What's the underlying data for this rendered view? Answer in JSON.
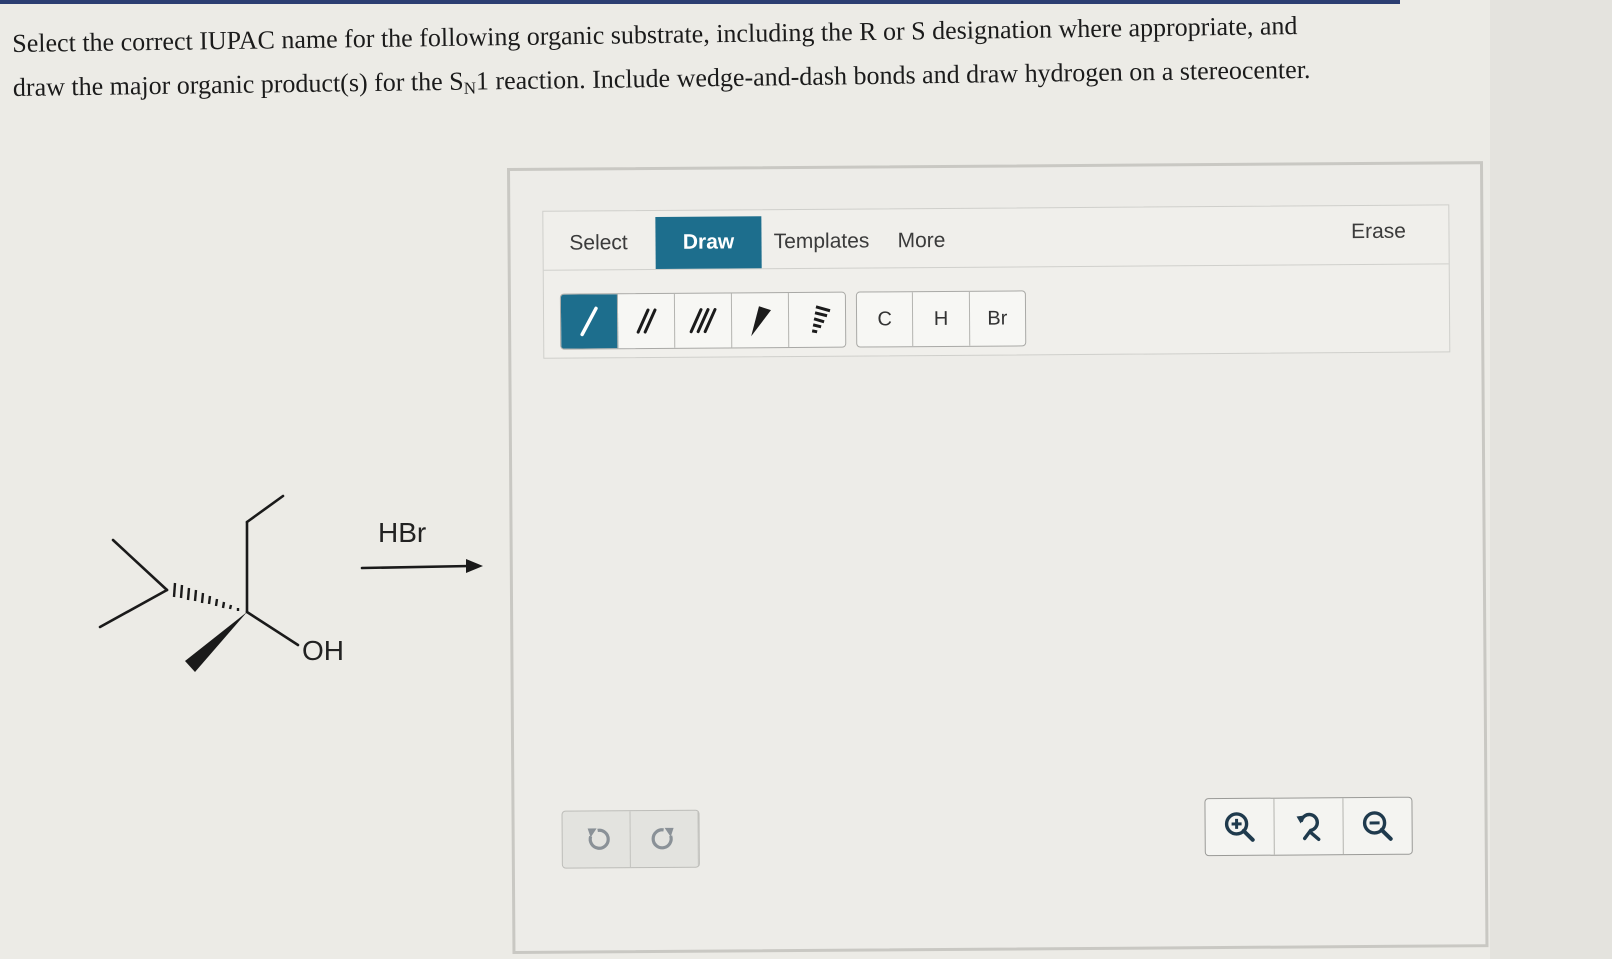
{
  "question": {
    "line1": "Select the correct IUPAC name for the following organic substrate, including the R or S designation where appropriate, and",
    "line2_a": "draw the major organic product(s) for the S",
    "line2_sub": "N",
    "line2_b": "1 reaction. Include wedge-and-dash bonds and draw hydrogen on a stereocenter."
  },
  "reaction": {
    "reagent": "HBr",
    "substituent_label": "OH"
  },
  "editor": {
    "tabs": [
      "Select",
      "Draw",
      "Templates",
      "More"
    ],
    "active_tab": "Draw",
    "erase_label": "Erase",
    "bond_tools": [
      "single-bond",
      "double-bond",
      "triple-bond",
      "wedge-bond",
      "dash-bond"
    ],
    "atoms": [
      "C",
      "H",
      "Br"
    ],
    "history": [
      "undo",
      "redo"
    ],
    "zoom": [
      "zoom-in",
      "zoom-reset",
      "zoom-out"
    ],
    "accent_color": "#1d6e8d"
  }
}
